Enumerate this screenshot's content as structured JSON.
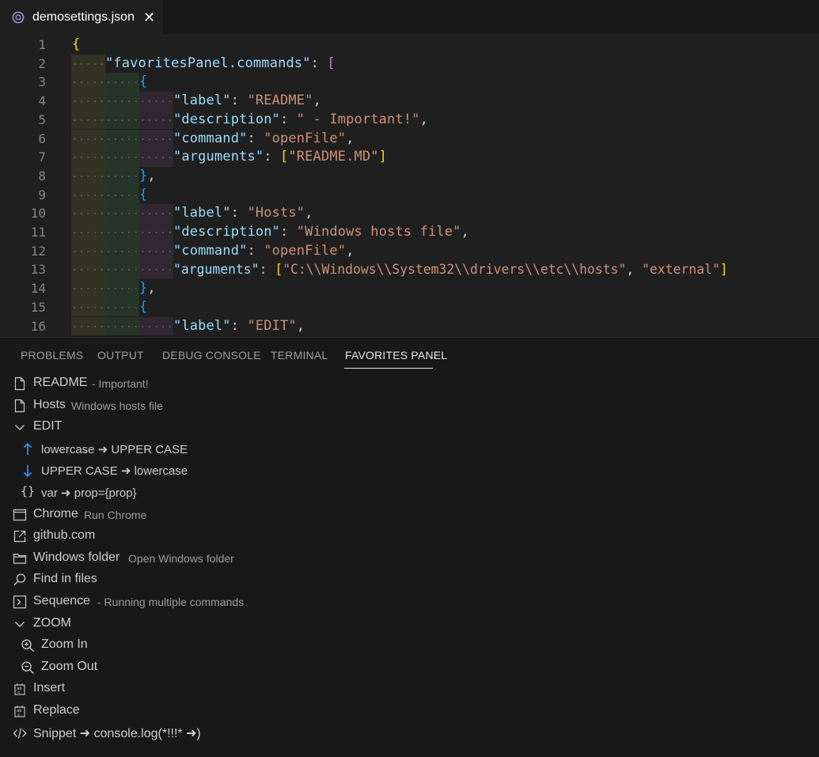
{
  "tab": {
    "title": "demosettings.json",
    "close_glyph": "✕",
    "icon": "json-icon"
  },
  "editor": {
    "line_numbers": [
      "1",
      "2",
      "3",
      "4",
      "5",
      "6",
      "7",
      "8",
      "9",
      "10",
      "11",
      "12",
      "13",
      "14",
      "15",
      "16"
    ],
    "lines": [
      "{",
      "\"favoritesPanel.commands\": [",
      "{",
      "\"label\": \"README\",",
      "\"description\": \" - Important!\",",
      "\"command\": \"openFile\",",
      "\"arguments\": [\"README.MD\"]",
      "},",
      "{",
      "\"label\": \"Hosts\",",
      "\"description\": \"Windows hosts file\",",
      "\"command\": \"openFile\",",
      "\"arguments\": [\"C:\\\\Windows\\\\System32\\\\drivers\\\\etc\\\\hosts\", \"external\"]",
      "},",
      "{",
      "\"label\": \"EDIT\","
    ],
    "tokens": {
      "l1_b": "{",
      "l2_k": "\"favoritesPanel.commands\"",
      "l2_p": ": ",
      "l2_b": "[",
      "l3_b": "{",
      "l4_k": "\"label\"",
      "l4_p": ": ",
      "l4_s": "\"README\"",
      "l4_c": ",",
      "l5_k": "\"description\"",
      "l5_p": ": ",
      "l5_s": "\" - Important!\"",
      "l5_c": ",",
      "l6_k": "\"command\"",
      "l6_p": ": ",
      "l6_s": "\"openFile\"",
      "l6_c": ",",
      "l7_k": "\"arguments\"",
      "l7_p": ": ",
      "l7_b1": "[",
      "l7_s": "\"README.MD\"",
      "l7_b2": "]",
      "l8_b": "}",
      "l8_c": ",",
      "l9_b": "{",
      "l10_k": "\"label\"",
      "l10_p": ": ",
      "l10_s": "\"Hosts\"",
      "l10_c": ",",
      "l11_k": "\"description\"",
      "l11_p": ": ",
      "l11_s": "\"Windows hosts file\"",
      "l11_c": ",",
      "l12_k": "\"command\"",
      "l12_p": ": ",
      "l12_s": "\"openFile\"",
      "l12_c": ",",
      "l13_k": "\"arguments\"",
      "l13_p": ": ",
      "l13_b1": "[",
      "l13_s1": "\"C:\\\\Windows\\\\System32\\\\drivers\\\\etc\\\\hosts\"",
      "l13_c": ", ",
      "l13_s2": "\"external\"",
      "l13_b2": "]",
      "l14_b": "}",
      "l14_c": ",",
      "l15_b": "{",
      "l16_k": "\"label\"",
      "l16_p": ": ",
      "l16_s": "\"EDIT\"",
      "l16_c": ","
    }
  },
  "panel": {
    "tabs": [
      "PROBLEMS",
      "OUTPUT",
      "DEBUG CONSOLE",
      "TERMINAL",
      "FAVORITES PANEL"
    ],
    "active_tab": "FAVORITES PANEL",
    "items": [
      {
        "label": "README",
        "description": "- Important!",
        "icon": "file-icon"
      },
      {
        "label": "Hosts",
        "description": "Windows hosts file",
        "icon": "file-icon"
      },
      {
        "label": "EDIT",
        "description": "",
        "icon": "chevron-down-icon"
      },
      {
        "label": "lowercase ➜ UPPER CASE",
        "description": "",
        "icon": "arrow-up-icon"
      },
      {
        "label": "UPPER CASE ➜ lowercase",
        "description": "",
        "icon": "arrow-down-icon"
      },
      {
        "label": "var ➜ prop={prop}",
        "description": "",
        "icon": "braces-icon"
      },
      {
        "label": "Chrome",
        "description": "Run Chrome",
        "icon": "window-icon"
      },
      {
        "label": "github.com",
        "description": "",
        "icon": "link-external-icon"
      },
      {
        "label": "Windows folder",
        "description": "Open Windows folder",
        "icon": "folder-icon"
      },
      {
        "label": "Find in files",
        "description": "",
        "icon": "search-icon"
      },
      {
        "label": "Sequence",
        "description": "- Running multiple commands",
        "icon": "terminal-icon"
      },
      {
        "label": "ZOOM",
        "description": "",
        "icon": "chevron-down-icon"
      },
      {
        "label": "Zoom In",
        "description": "",
        "icon": "zoom-in-icon"
      },
      {
        "label": "Zoom Out",
        "description": "",
        "icon": "zoom-out-icon"
      },
      {
        "label": "Insert",
        "description": "",
        "icon": "symbol-key-icon"
      },
      {
        "label": "Replace",
        "description": "",
        "icon": "symbol-key-icon"
      },
      {
        "label": "Snippet ➜ console.log(*!!!* ➜)",
        "description": "",
        "icon": "code-icon"
      }
    ]
  },
  "colors": {
    "background": "#1f1f1f",
    "panel_background": "#181818",
    "key": "#9cdcfe",
    "string": "#ce9178",
    "bracket_gold": "#ffd700",
    "bracket_orchid": "#da70d6",
    "bracket_blue": "#179fff",
    "accent_icon": "#3794ff"
  }
}
